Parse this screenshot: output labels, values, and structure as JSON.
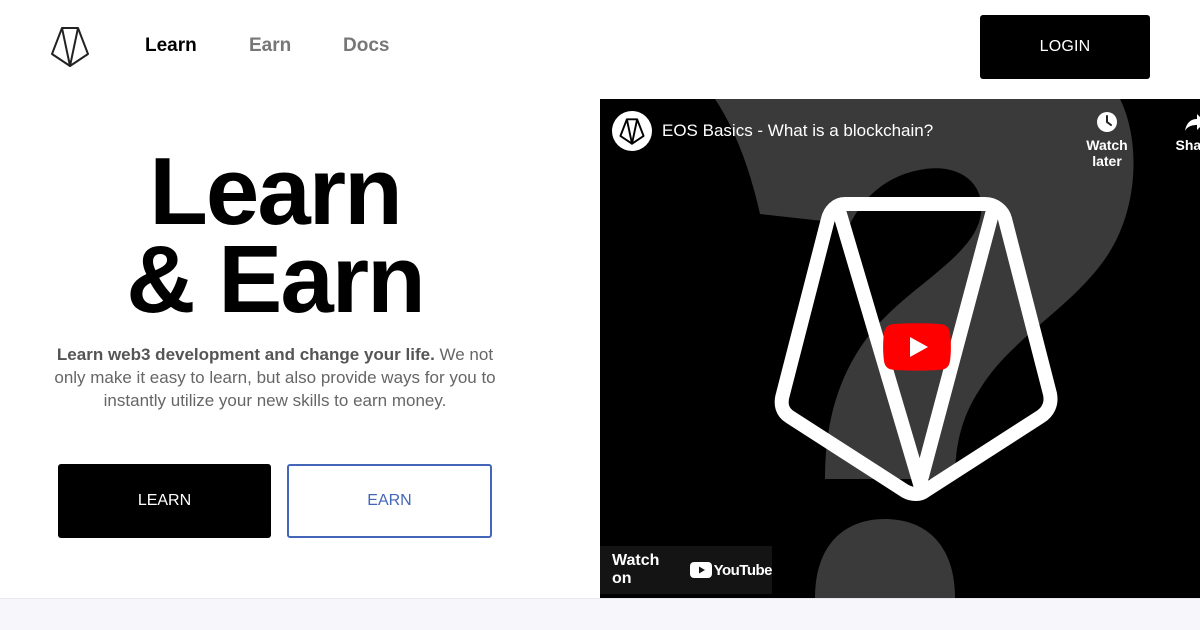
{
  "nav": {
    "logo_icon": "eos-logo-icon",
    "links": [
      {
        "label": "Learn",
        "active": true
      },
      {
        "label": "Earn",
        "active": false
      },
      {
        "label": "Docs",
        "active": false
      }
    ],
    "login_label": "LOGIN"
  },
  "hero": {
    "title_line1": "Learn",
    "title_line2": "& Earn",
    "subtitle_bold": "Learn web3 development and change your life.",
    "subtitle_rest": " We not only make it easy to learn, but also provide ways for you to instantly utilize your new skills to earn money.",
    "learn_button": "LEARN",
    "earn_button": "EARN"
  },
  "video": {
    "title": "EOS Basics - What is a blockchain?",
    "watch_later": "Watch later",
    "share": "Share",
    "watch_on": "Watch on",
    "youtube": "YouTube",
    "icons": {
      "channel": "eos-logo-icon",
      "watch_later": "clock-icon",
      "share": "share-arrow-icon",
      "play": "play-button-icon",
      "youtube": "youtube-logo-icon"
    }
  },
  "colors": {
    "primary": "#000000",
    "accent_blue": "#4466b8",
    "youtube_red": "#ff0000",
    "muted_text": "#777777"
  }
}
